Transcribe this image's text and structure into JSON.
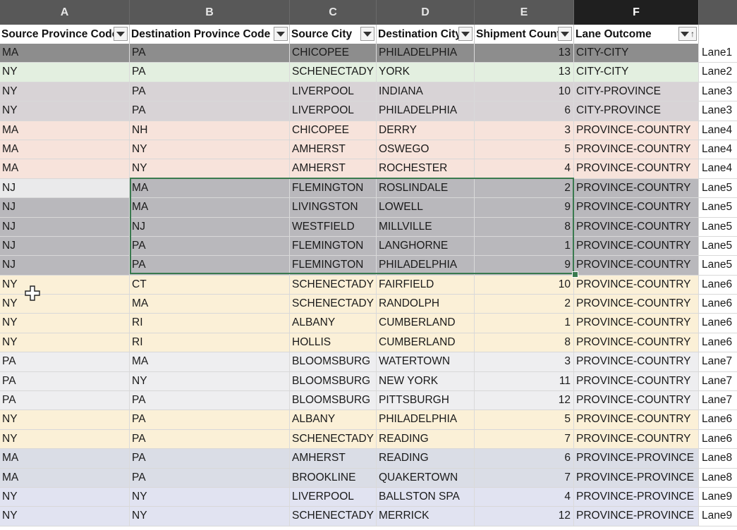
{
  "columns": [
    "A",
    "B",
    "C",
    "D",
    "E",
    "F",
    ""
  ],
  "headers": [
    {
      "label": "Source Province Code",
      "filter": "filter"
    },
    {
      "label": "Destination Province Code",
      "filter": "filter"
    },
    {
      "label": "Source City",
      "filter": "filter"
    },
    {
      "label": "Destination City",
      "filter": "filter"
    },
    {
      "label": "Shipment Count",
      "filter": "filter"
    },
    {
      "label": "Lane Outcome",
      "filter": "sorted"
    }
  ],
  "colors": {
    "dark_gray": "#8d8d8d",
    "light_green": "#e3efe0",
    "mauve_gray": "#d8d3d6",
    "peach": "#f7e3db",
    "mid_gray": "#b9b8bc",
    "light_yellow": "#fbf0d7",
    "pale_gray": "#eeeef0",
    "blue_gray": "#dadde6",
    "lavender": "#e1e3f1",
    "selection_light": "#eaeaeb",
    "selection_border": "#3a7a4f"
  },
  "rows": [
    {
      "a": "MA",
      "b": "PA",
      "c": "CHICOPEE",
      "d": "PHILADELPHIA",
      "e": "13",
      "f": "CITY-CITY",
      "g": "Lane1",
      "color": "#8d8d8d"
    },
    {
      "a": "NY",
      "b": "PA",
      "c": "SCHENECTADY",
      "d": "YORK",
      "e": "13",
      "f": "CITY-CITY",
      "g": "Lane2",
      "color": "#e3efe0"
    },
    {
      "a": "NY",
      "b": "PA",
      "c": "LIVERPOOL",
      "d": "INDIANA",
      "e": "10",
      "f": "CITY-PROVINCE",
      "g": "Lane3",
      "color": "#d8d3d6"
    },
    {
      "a": "NY",
      "b": "PA",
      "c": "LIVERPOOL",
      "d": "PHILADELPHIA",
      "e": "6",
      "f": "CITY-PROVINCE",
      "g": "Lane3",
      "color": "#d8d3d6"
    },
    {
      "a": "MA",
      "b": "NH",
      "c": "CHICOPEE",
      "d": "DERRY",
      "e": "3",
      "f": "PROVINCE-COUNTRY",
      "g": "Lane4",
      "color": "#f7e3db"
    },
    {
      "a": "MA",
      "b": "NY",
      "c": "AMHERST",
      "d": "OSWEGO",
      "e": "5",
      "f": "PROVINCE-COUNTRY",
      "g": "Lane4",
      "color": "#f7e3db"
    },
    {
      "a": "MA",
      "b": "NY",
      "c": "AMHERST",
      "d": "ROCHESTER",
      "e": "4",
      "f": "PROVINCE-COUNTRY",
      "g": "Lane4",
      "color": "#f7e3db"
    },
    {
      "a": "NJ",
      "b": "MA",
      "c": "FLEMINGTON",
      "d": "ROSLINDALE",
      "e": "2",
      "f": "PROVINCE-COUNTRY",
      "g": "Lane5",
      "color": "#b9b8bc",
      "first_cell_color": "#eaeaeb"
    },
    {
      "a": "NJ",
      "b": "MA",
      "c": "LIVINGSTON",
      "d": "LOWELL",
      "e": "9",
      "f": "PROVINCE-COUNTRY",
      "g": "Lane5",
      "color": "#b9b8bc"
    },
    {
      "a": "NJ",
      "b": "NJ",
      "c": "WESTFIELD",
      "d": "MILLVILLE",
      "e": "8",
      "f": "PROVINCE-COUNTRY",
      "g": "Lane5",
      "color": "#b9b8bc"
    },
    {
      "a": "NJ",
      "b": "PA",
      "c": "FLEMINGTON",
      "d": "LANGHORNE",
      "e": "1",
      "f": "PROVINCE-COUNTRY",
      "g": "Lane5",
      "color": "#b9b8bc"
    },
    {
      "a": "NJ",
      "b": "PA",
      "c": "FLEMINGTON",
      "d": "PHILADELPHIA",
      "e": "9",
      "f": "PROVINCE-COUNTRY",
      "g": "Lane5",
      "color": "#b9b8bc"
    },
    {
      "a": "NY",
      "b": "CT",
      "c": "SCHENECTADY",
      "d": "FAIRFIELD",
      "e": "10",
      "f": "PROVINCE-COUNTRY",
      "g": "Lane6",
      "color": "#fbf0d7"
    },
    {
      "a": "NY",
      "b": "MA",
      "c": "SCHENECTADY",
      "d": "RANDOLPH",
      "e": "2",
      "f": "PROVINCE-COUNTRY",
      "g": "Lane6",
      "color": "#fbf0d7"
    },
    {
      "a": "NY",
      "b": "RI",
      "c": "ALBANY",
      "d": "CUMBERLAND",
      "e": "1",
      "f": "PROVINCE-COUNTRY",
      "g": "Lane6",
      "color": "#fbf0d7"
    },
    {
      "a": "NY",
      "b": "RI",
      "c": "HOLLIS",
      "d": "CUMBERLAND",
      "e": "8",
      "f": "PROVINCE-COUNTRY",
      "g": "Lane6",
      "color": "#fbf0d7"
    },
    {
      "a": "PA",
      "b": "MA",
      "c": "BLOOMSBURG",
      "d": "WATERTOWN",
      "e": "3",
      "f": "PROVINCE-COUNTRY",
      "g": "Lane7",
      "color": "#eeeef0"
    },
    {
      "a": "PA",
      "b": "NY",
      "c": "BLOOMSBURG",
      "d": "NEW YORK",
      "e": "11",
      "f": "PROVINCE-COUNTRY",
      "g": "Lane7",
      "color": "#eeeef0"
    },
    {
      "a": "PA",
      "b": "PA",
      "c": "BLOOMSBURG",
      "d": "PITTSBURGH",
      "e": "12",
      "f": "PROVINCE-COUNTRY",
      "g": "Lane7",
      "color": "#eeeef0"
    },
    {
      "a": "NY",
      "b": "PA",
      "c": "ALBANY",
      "d": "PHILADELPHIA",
      "e": "5",
      "f": "PROVINCE-COUNTRY",
      "g": "Lane6",
      "color": "#fbf0d7"
    },
    {
      "a": "NY",
      "b": "PA",
      "c": "SCHENECTADY",
      "d": "READING",
      "e": "7",
      "f": "PROVINCE-COUNTRY",
      "g": "Lane6",
      "color": "#fbf0d7"
    },
    {
      "a": "MA",
      "b": "PA",
      "c": "AMHERST",
      "d": "READING",
      "e": "6",
      "f": "PROVINCE-PROVINCE",
      "g": "Lane8",
      "color": "#dadde6"
    },
    {
      "a": "MA",
      "b": "PA",
      "c": "BROOKLINE",
      "d": "QUAKERTOWN",
      "e": "7",
      "f": "PROVINCE-PROVINCE",
      "g": "Lane8",
      "color": "#dadde6"
    },
    {
      "a": "NY",
      "b": "NY",
      "c": "LIVERPOOL",
      "d": "BALLSTON SPA",
      "e": "4",
      "f": "PROVINCE-PROVINCE",
      "g": "Lane9",
      "color": "#e1e3f1"
    },
    {
      "a": "NY",
      "b": "NY",
      "c": "SCHENECTADY",
      "d": "MERRICK",
      "e": "12",
      "f": "PROVINCE-PROVINCE",
      "g": "Lane9",
      "color": "#e1e3f1"
    }
  ]
}
